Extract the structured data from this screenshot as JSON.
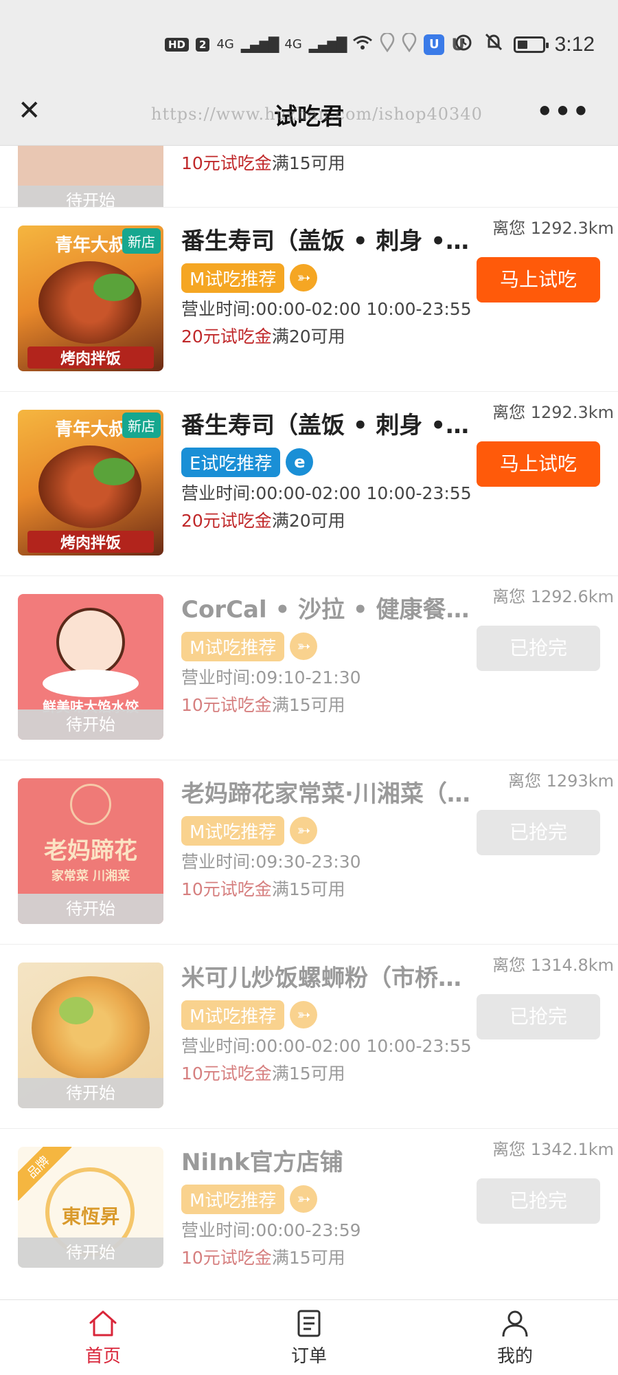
{
  "status_bar": {
    "hd_label": "HD",
    "sim_label": "2",
    "net1": "4G",
    "net2": "4G",
    "time": "3:12"
  },
  "nav": {
    "title": "试吃君",
    "watermark": "https://www.huzhan.com/ishop40340"
  },
  "partial_item": {
    "caption": "待开始",
    "coupon_amount": "10元试吃金",
    "coupon_condition": "满15可用"
  },
  "items": [
    {
      "name": "番生寿司（盖饭 • 刺身 • 寿司）",
      "distance": "离您 1292.3km",
      "badge": "新店",
      "art_title": "青年大叔",
      "art_banner": "烤肉拌饭",
      "tag": "M试吃推荐",
      "tag_icon": "➳",
      "hours": "营业时间:00:00-02:00 10:00-23:55",
      "coupon_amount": "20元试吃金",
      "coupon_condition": "满20可用",
      "button": "马上试吃"
    },
    {
      "name": "番生寿司（盖饭 • 刺身 • 寿司）",
      "distance": "离您 1292.3km",
      "badge": "新店",
      "art_title": "青年大叔",
      "art_banner": "烤肉拌饭",
      "tag": "E试吃推荐",
      "tag_icon": "e",
      "hours": "营业时间:00:00-02:00 10:00-23:55",
      "coupon_amount": "20元试吃金",
      "coupon_condition": "满20可用",
      "button": "马上试吃"
    },
    {
      "name": "CorCal • 沙拉 • 健康餐 • 轻食",
      "distance": "离您 1292.6km",
      "art_title": "鲜美味大馅水饺",
      "caption": "待开始",
      "tag": "M试吃推荐",
      "tag_icon": "➳",
      "hours": "营业时间:09:10-21:30",
      "coupon_amount": "10元试吃金",
      "coupon_condition": "满15可用",
      "button": "已抢完"
    },
    {
      "name": "老妈蹄花家常菜·川湘菜（总店）",
      "distance": "离您 1293km",
      "art_title": "老妈蹄花",
      "art_sub": "家常菜 川湘菜",
      "caption": "待开始",
      "tag": "M试吃推荐",
      "tag_icon": "➳",
      "hours": "营业时间:09:30-23:30",
      "coupon_amount": "10元试吃金",
      "coupon_condition": "满15可用",
      "button": "已抢完"
    },
    {
      "name": "米可儿炒饭螺蛳粉（市桥店）",
      "distance": "离您 1314.8km",
      "caption": "待开始",
      "tag": "M试吃推荐",
      "tag_icon": "➳",
      "hours": "营业时间:00:00-02:00 10:00-23:55",
      "coupon_amount": "10元试吃金",
      "coupon_condition": "满15可用",
      "button": "已抢完"
    },
    {
      "name": "NiInk官方店铺",
      "distance": "离您 1342.1km",
      "corner": "品牌",
      "art_title": "東恆昇",
      "caption": "待开始",
      "tag": "M试吃推荐",
      "tag_icon": "➳",
      "hours": "营业时间:00:00-23:59",
      "coupon_amount": "10元试吃金",
      "coupon_condition": "满15可用",
      "button": "已抢完"
    }
  ],
  "tabs": [
    {
      "label": "首页",
      "icon": "home-icon"
    },
    {
      "label": "订单",
      "icon": "order-list-icon"
    },
    {
      "label": "我的",
      "icon": "user-icon"
    }
  ],
  "colors": {
    "primary_button": "#ff5a0a",
    "m_tag": "#f5a623",
    "e_tag": "#1a8fd6",
    "active_tab": "#d9263a",
    "coupon": "#c0282a"
  }
}
